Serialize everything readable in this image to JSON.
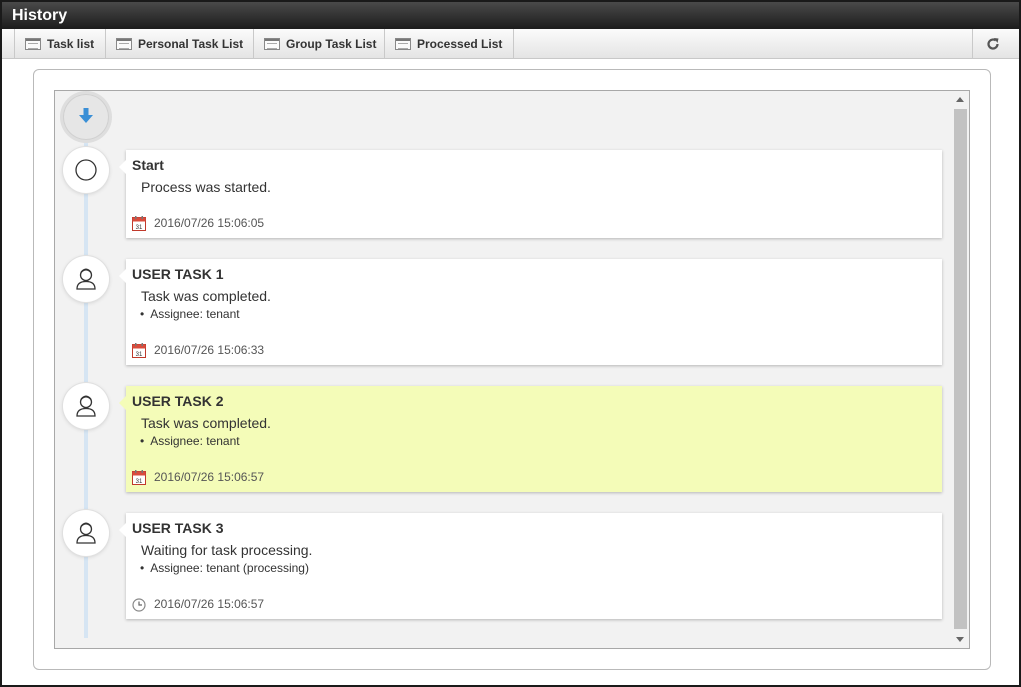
{
  "window": {
    "title": "History"
  },
  "toolbar": {
    "tabs": [
      {
        "label": "Task list"
      },
      {
        "label": "Personal Task List"
      },
      {
        "label": "Group Task List"
      },
      {
        "label": "Processed List"
      }
    ],
    "refresh_icon": "refresh-icon"
  },
  "timeline": {
    "entries": [
      {
        "title": "Start",
        "description": "Process was started.",
        "assignee": "",
        "date": "2016/07/26 15:06:05",
        "node_icon": "circle-icon",
        "date_icon": "calendar-icon",
        "highlighted": false
      },
      {
        "title": "USER TASK 1",
        "description": "Task was completed.",
        "assignee": "Assignee: tenant",
        "date": "2016/07/26 15:06:33",
        "node_icon": "user-icon",
        "date_icon": "calendar-icon",
        "highlighted": false
      },
      {
        "title": "USER TASK 2",
        "description": "Task was completed.",
        "assignee": "Assignee: tenant",
        "date": "2016/07/26 15:06:57",
        "node_icon": "user-icon",
        "date_icon": "calendar-icon",
        "highlighted": true
      },
      {
        "title": "USER TASK 3",
        "description": "Waiting for task processing.",
        "assignee": "Assignee: tenant (processing)",
        "date": "2016/07/26 15:06:57",
        "node_icon": "user-icon",
        "date_icon": "clock-icon",
        "highlighted": false
      }
    ]
  },
  "colors": {
    "highlight": "#f4fcb8",
    "timeline_line": "#d6e5f3",
    "titlebar": "#2a2a2a",
    "arrow": "#3a8fd6"
  }
}
